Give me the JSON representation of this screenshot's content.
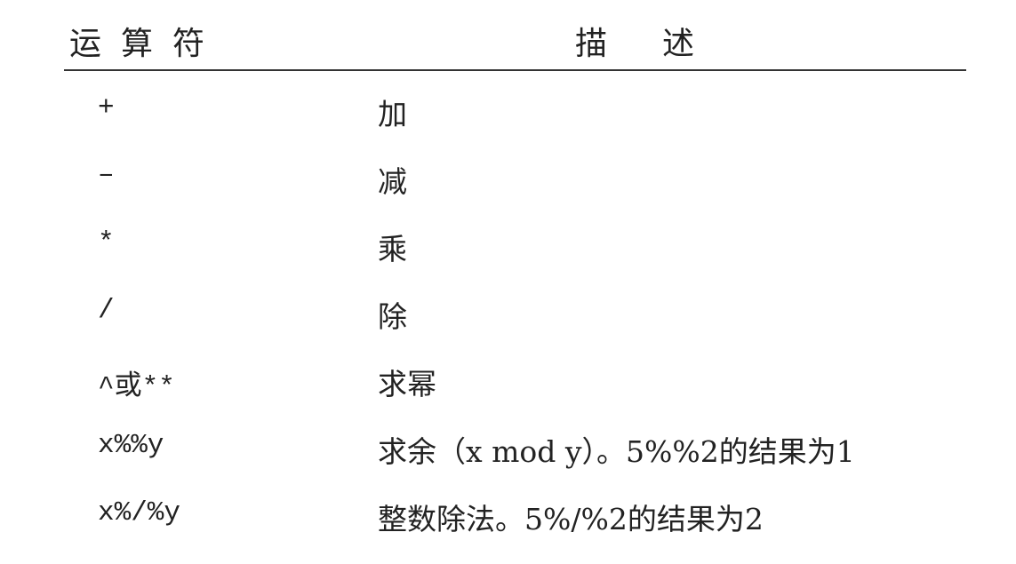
{
  "table": {
    "headers": [
      "运算符",
      "描述"
    ],
    "rows": [
      {
        "op": "+",
        "desc": "加"
      },
      {
        "op": "–",
        "desc": "减"
      },
      {
        "op": "*",
        "desc": "乘"
      },
      {
        "op": "/",
        "desc": "除"
      },
      {
        "op": "^或**",
        "desc": "求幂"
      },
      {
        "op": "x%%y",
        "desc": "求余（x mod y）。5%%2的结果为1"
      },
      {
        "op": "x%/%y",
        "desc": "整数除法。5%/%2的结果为2"
      }
    ]
  }
}
